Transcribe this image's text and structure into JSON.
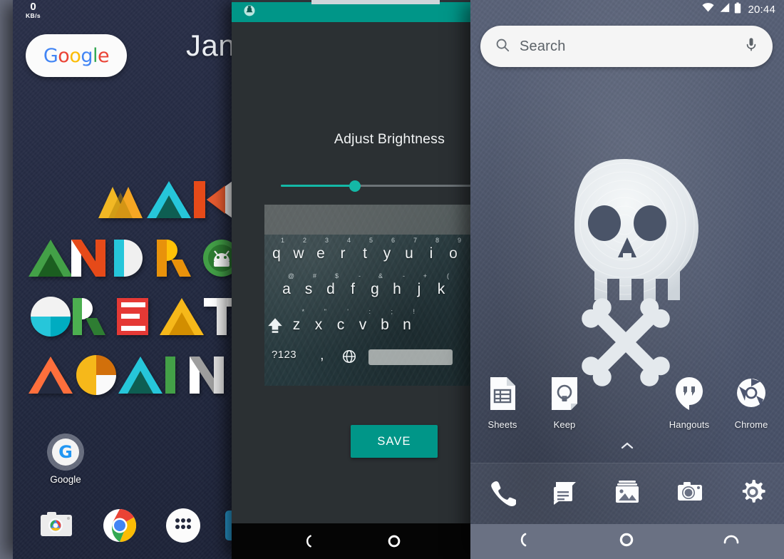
{
  "panels": {
    "left": {
      "name": "android-home-screen-make-android-great-again",
      "network_speed": {
        "value": "0",
        "unit": "KB/s"
      },
      "google_pill": {
        "label": "Google",
        "letters": [
          "G",
          "o",
          "o",
          "g",
          "l",
          "e"
        ]
      },
      "date_widget": {
        "text": "Janu"
      },
      "wallpaper": {
        "type": "typographic",
        "lines": [
          "MAKE",
          "ANDROID",
          "GREAT",
          "AGAIN"
        ],
        "background_color": "#242b40",
        "palette": [
          "#F5A623",
          "#FFC107",
          "#26C6DA",
          "#00BFA5",
          "#E64A19",
          "#43A047",
          "#4CAF50",
          "#FFFFFF",
          "#EF5350",
          "#FF7043",
          "#E65100",
          "#FFFFFF"
        ]
      },
      "folder": {
        "label": "Google",
        "glyph": "G"
      },
      "dock_items": [
        {
          "name": "camera",
          "label": "Camera"
        },
        {
          "name": "chrome",
          "label": "Chrome"
        },
        {
          "name": "app-drawer",
          "label": "Apps"
        },
        {
          "name": "blue-app",
          "label": "App"
        }
      ]
    },
    "middle": {
      "name": "adjust-brightness-settings",
      "toolbar_color": "#009688",
      "status_icon": "notification-icon",
      "title": "Adjust Brightness",
      "slider": {
        "value": 37,
        "min": 0,
        "max": 100,
        "accent": "#14B8A6",
        "track": "#6d7478"
      },
      "keyboard_preview": {
        "rows": [
          [
            {
              "key": "q",
              "sup": "1"
            },
            {
              "key": "w",
              "sup": "2"
            },
            {
              "key": "e",
              "sup": "3"
            },
            {
              "key": "r",
              "sup": "4"
            },
            {
              "key": "t",
              "sup": "5"
            },
            {
              "key": "y",
              "sup": "6"
            },
            {
              "key": "u",
              "sup": "7"
            },
            {
              "key": "i",
              "sup": "8"
            },
            {
              "key": "o",
              "sup": "9"
            }
          ],
          [
            {
              "key": "a",
              "sup": "@"
            },
            {
              "key": "s",
              "sup": "#"
            },
            {
              "key": "d",
              "sup": "$"
            },
            {
              "key": "f",
              "sup": "-"
            },
            {
              "key": "g",
              "sup": "&"
            },
            {
              "key": "h",
              "sup": "-"
            },
            {
              "key": "j",
              "sup": "+"
            },
            {
              "key": "k",
              "sup": "("
            }
          ],
          [
            {
              "key": "z",
              "sup": "*"
            },
            {
              "key": "x",
              "sup": "\""
            },
            {
              "key": "c",
              "sup": "'"
            },
            {
              "key": "v",
              "sup": ":"
            },
            {
              "key": "b",
              "sup": ";"
            },
            {
              "key": "n",
              "sup": "!"
            }
          ]
        ],
        "shift_key": "shift-icon",
        "symbols_key": "?123",
        "comma_key": ",",
        "globe_key": "globe-icon",
        "space_key": ""
      },
      "save_button": {
        "label": "SAVE",
        "color": "#009688"
      },
      "navbar": [
        {
          "name": "back-icon"
        },
        {
          "name": "home-icon"
        }
      ]
    },
    "right": {
      "name": "android-home-screen-skull",
      "statusbar": {
        "wifi": "wifi-icon",
        "signal": "signal-icon",
        "battery": "battery-icon",
        "clock": "20:44"
      },
      "search": {
        "placeholder": "Search",
        "search_icon": "search-icon",
        "mic_icon": "microphone-icon"
      },
      "wallpaper": {
        "type": "skull-and-crossbones",
        "background_color": "#4d5670",
        "skull_color": "#e8ecef"
      },
      "apps": [
        {
          "label": "Sheets",
          "icon": "sheets-icon"
        },
        {
          "label": "Keep",
          "icon": "keep-icon"
        },
        {
          "label": "Hangouts",
          "icon": "hangouts-icon"
        },
        {
          "label": "Chrome",
          "icon": "chrome-icon"
        }
      ],
      "drawer_handle": "chevron-up-icon",
      "dock": [
        {
          "name": "phone-icon",
          "label": "Phone"
        },
        {
          "name": "messages-icon",
          "label": "Messages"
        },
        {
          "name": "gallery-icon",
          "label": "Gallery"
        },
        {
          "name": "camera-icon",
          "label": "Camera"
        },
        {
          "name": "settings-icon",
          "label": "Settings"
        }
      ],
      "navbar": [
        {
          "name": "back-icon"
        },
        {
          "name": "home-icon"
        },
        {
          "name": "recents-icon"
        }
      ]
    }
  }
}
